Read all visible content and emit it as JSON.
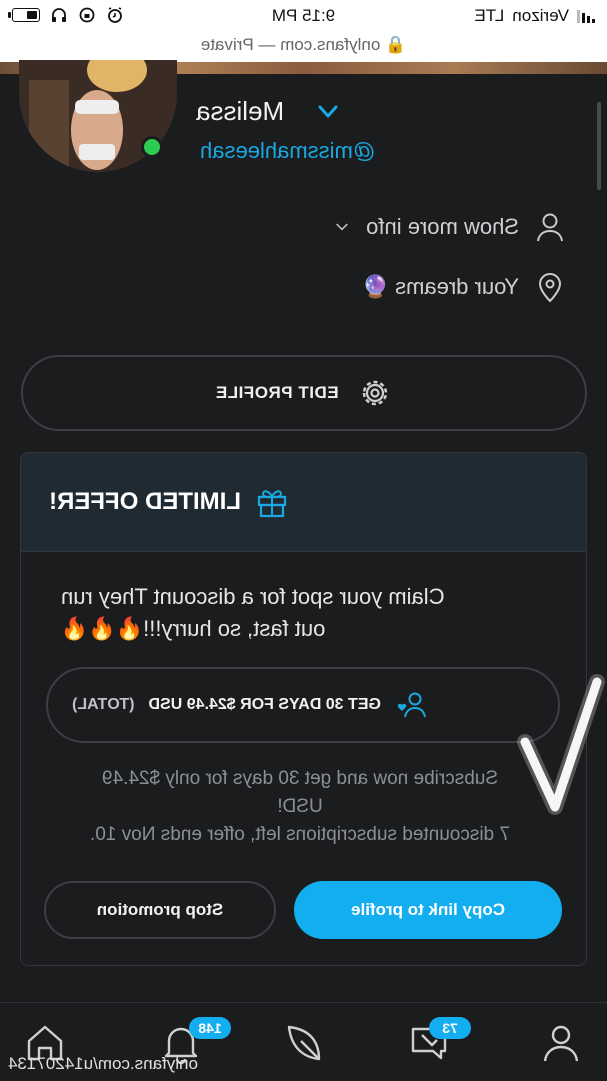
{
  "status_bar": {
    "carrier": "Verizon",
    "network": "LTE",
    "time": "9:15 PM"
  },
  "url_bar": {
    "text": "onlyfans.com — Private"
  },
  "profile": {
    "name": "Melissa",
    "handle": "@missmahleesah",
    "show_more_label": "Show more info",
    "location_text": "Your dreams 🔮",
    "edit_profile_label": "EDIT PROFILE"
  },
  "offer": {
    "title": "LIMITED OFFER!",
    "claim_line1": "Claim your spot for a discount      They run",
    "claim_line2": "out fast, so hurry!!!🔥🔥🔥",
    "get_button_main": "GET 30 DAYS FOR $24.49 USD",
    "get_button_suffix": "(TOTAL)",
    "terms_line1": "Subscribe now and get 30 days for only $24.49",
    "terms_line2": "USD!",
    "terms_line3": "7 discounted subscriptions left, offer ends Nov 10.",
    "stop_label": "Stop promotion",
    "copy_label": "Copy link to profile"
  },
  "bottom_nav": {
    "messages_badge": "73",
    "notifications_badge": "148",
    "footer_url": "onlyfans.com/u14207134"
  },
  "colors": {
    "accent": "#12aef0",
    "background": "#1b1c1e",
    "online": "#2ecc52"
  }
}
